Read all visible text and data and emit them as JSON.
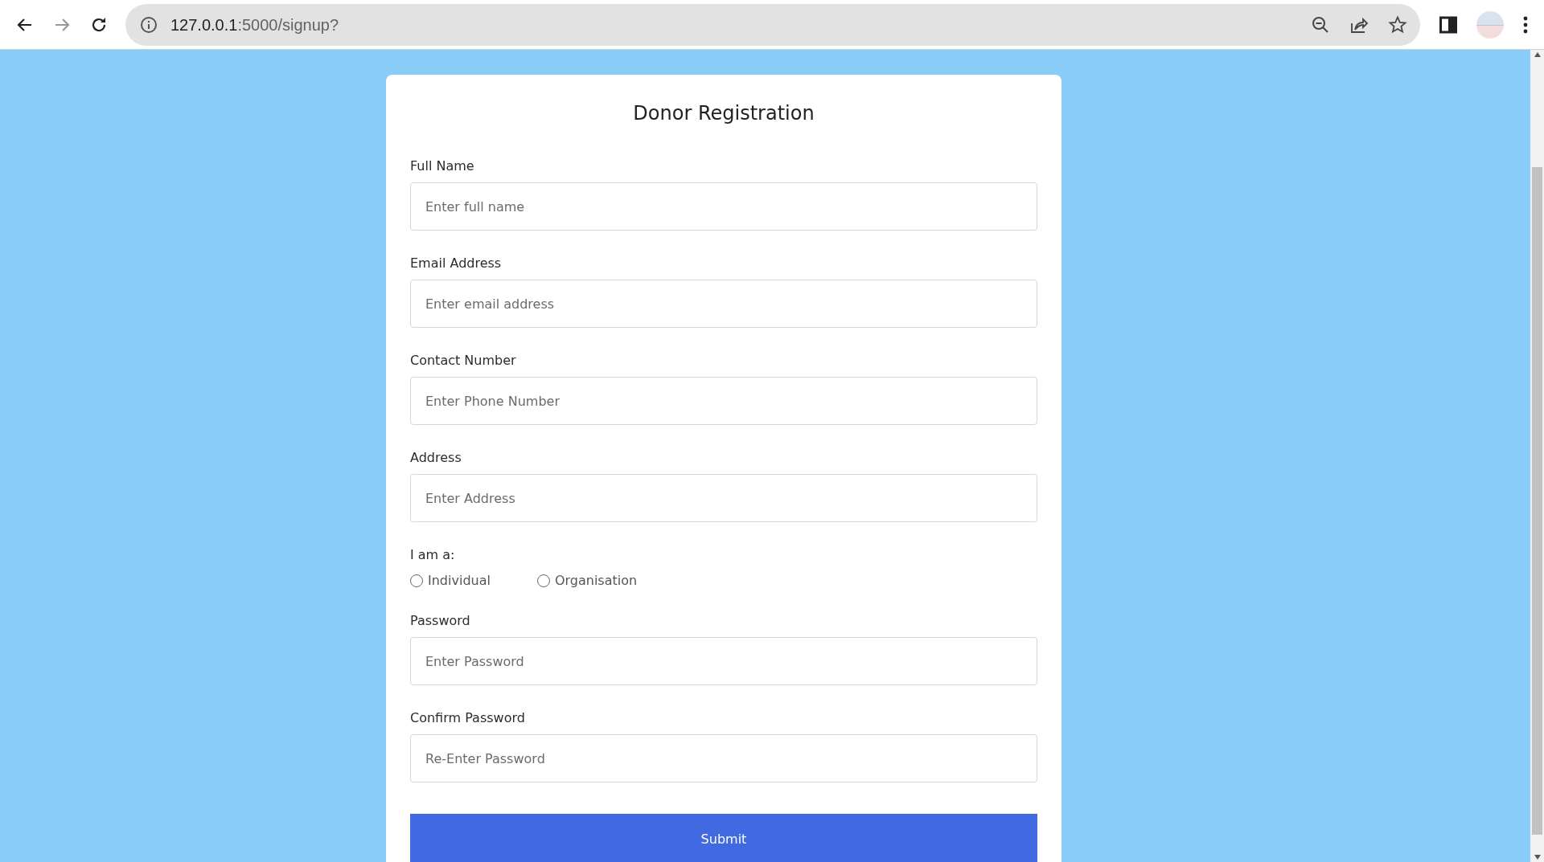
{
  "browser": {
    "url_host": "127.0.0.1",
    "url_path": ":5000/signup?"
  },
  "form": {
    "title": "Donor Registration",
    "fields": [
      {
        "kind": "text",
        "label": "Full Name",
        "placeholder": "Enter full name"
      },
      {
        "kind": "text",
        "label": "Email Address",
        "placeholder": "Enter email address"
      },
      {
        "kind": "text",
        "label": "Contact Number",
        "placeholder": "Enter Phone Number"
      },
      {
        "kind": "text",
        "label": "Address",
        "placeholder": "Enter Address"
      },
      {
        "kind": "radio",
        "label": "I am a:",
        "options": [
          {
            "label": "Individual",
            "selected": false
          },
          {
            "label": "Organisation",
            "selected": false
          }
        ]
      },
      {
        "kind": "text",
        "label": "Password",
        "placeholder": "Enter Password"
      },
      {
        "kind": "text",
        "label": "Confirm Password",
        "placeholder": "Re-Enter Password"
      }
    ],
    "submit": "Submit"
  }
}
